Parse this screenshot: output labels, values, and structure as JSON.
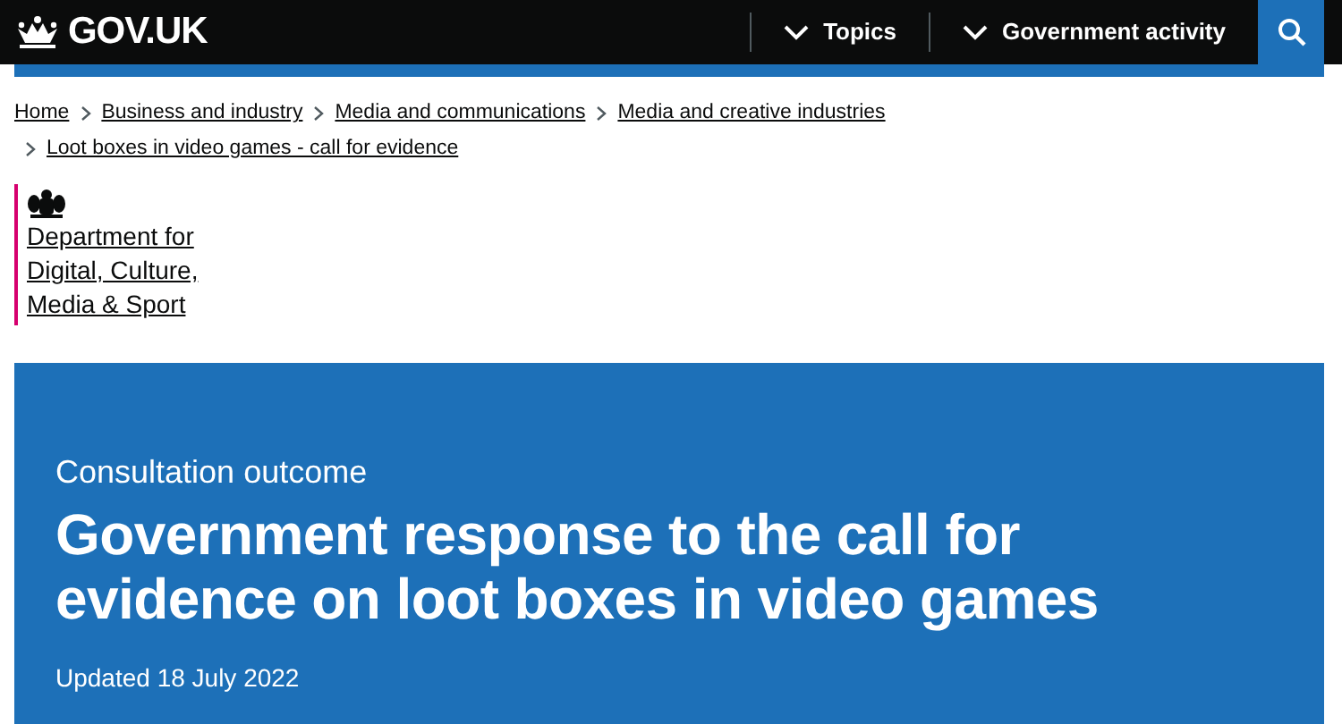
{
  "header": {
    "logo": "GOV.UK",
    "nav": [
      {
        "label": "Topics",
        "expanded": false
      },
      {
        "label": "Government activity",
        "expanded": false
      }
    ]
  },
  "breadcrumbs": [
    "Home",
    "Business and industry",
    "Media and communications",
    "Media and creative industries",
    "Loot boxes in video games - call for evidence"
  ],
  "organisation": {
    "name": "Department for Digital, Culture, Media & Sport"
  },
  "hero": {
    "label": "Consultation outcome",
    "title": "Government response to the call for evidence on loot boxes in video games",
    "updated": "Updated 18 July 2022"
  }
}
